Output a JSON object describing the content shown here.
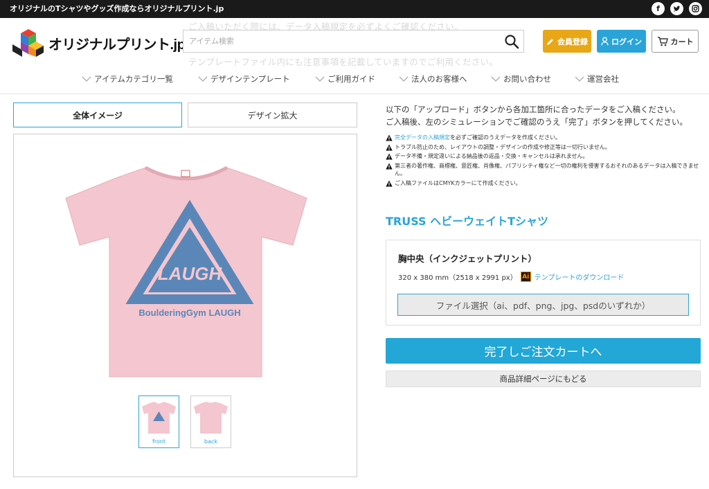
{
  "topbar": {
    "tagline": "オリジナルのTシャツやグッズ作成ならオリジナルプリント.jp"
  },
  "header": {
    "logo_text": "オリジナルプリント.jp",
    "search_placeholder": "アイテム検索",
    "register_label": "会員登録",
    "login_label": "ログイン",
    "cart_label": "カート",
    "ghost_line1": "ご入稿いただく際には、データ入稿規定を必ずよくご確認ください。",
    "ghost_line2": "テンプレートファイル内にも注意事項を記載していますのでご利用ください。"
  },
  "nav": [
    {
      "label": "アイテムカテゴリ一覧"
    },
    {
      "label": "デザインテンプレート"
    },
    {
      "label": "ご利用ガイド"
    },
    {
      "label": "法人のお客様へ"
    },
    {
      "label": "お問い合わせ"
    },
    {
      "label": "運営会社"
    }
  ],
  "tabs": {
    "overall": "全体イメージ",
    "zoom": "デザイン拡大"
  },
  "design": {
    "logo_text": "LAUGH",
    "caption": "BoulderingGym LAUGH",
    "shirt_color": "#f4c6cf",
    "print_color": "#5a87b8"
  },
  "thumbnails": [
    {
      "label": "front"
    },
    {
      "label": "back"
    }
  ],
  "intro": {
    "line1": "以下の「アップロード」ボタンから各加工箇所に合ったデータをご入稿ください。",
    "line2": "ご入稿後、左のシミュレーションでご確認のうえ「完了」ボタンを押してください。"
  },
  "notes": [
    {
      "link": "完全データの入稿規定",
      "text": "を必ずご確認のうえデータを作成ください。"
    },
    {
      "link": "",
      "text": "トラブル防止のため、レイアウトの調整・デザインの作成や修正等は一切行いません。"
    },
    {
      "link": "",
      "text": "データ不備・規定違いによる納品後の返品・交換・キャンセルは承れません。"
    },
    {
      "link": "",
      "text": "第三者の著作権、商標権、意匠権、肖像権、パブリシティ権など一切の権利を侵害するおそれのあるデータは入稿できません。"
    },
    {
      "link": "",
      "text": "ご入稿ファイルはCMYKカラーにて作成ください。"
    }
  ],
  "product": {
    "title": "TRUSS ヘビーウェイトTシャツ"
  },
  "upload": {
    "title": "胸中央（インクジェットプリント）",
    "size": "320 x 380 mm（2518 x 2991 px）",
    "ai_badge": "Ai",
    "template_link": "テンプレートのダウンロード",
    "file_button": "ファイル選択（ai、pdf、png、jpg、psdのいずれか）"
  },
  "actions": {
    "complete": "完了しご注文カートへ",
    "back": "商品詳細ページにもどる"
  },
  "colors": {
    "accent": "#2aa4d8",
    "register": "#e8a716",
    "topbar": "#1a1a1a"
  }
}
